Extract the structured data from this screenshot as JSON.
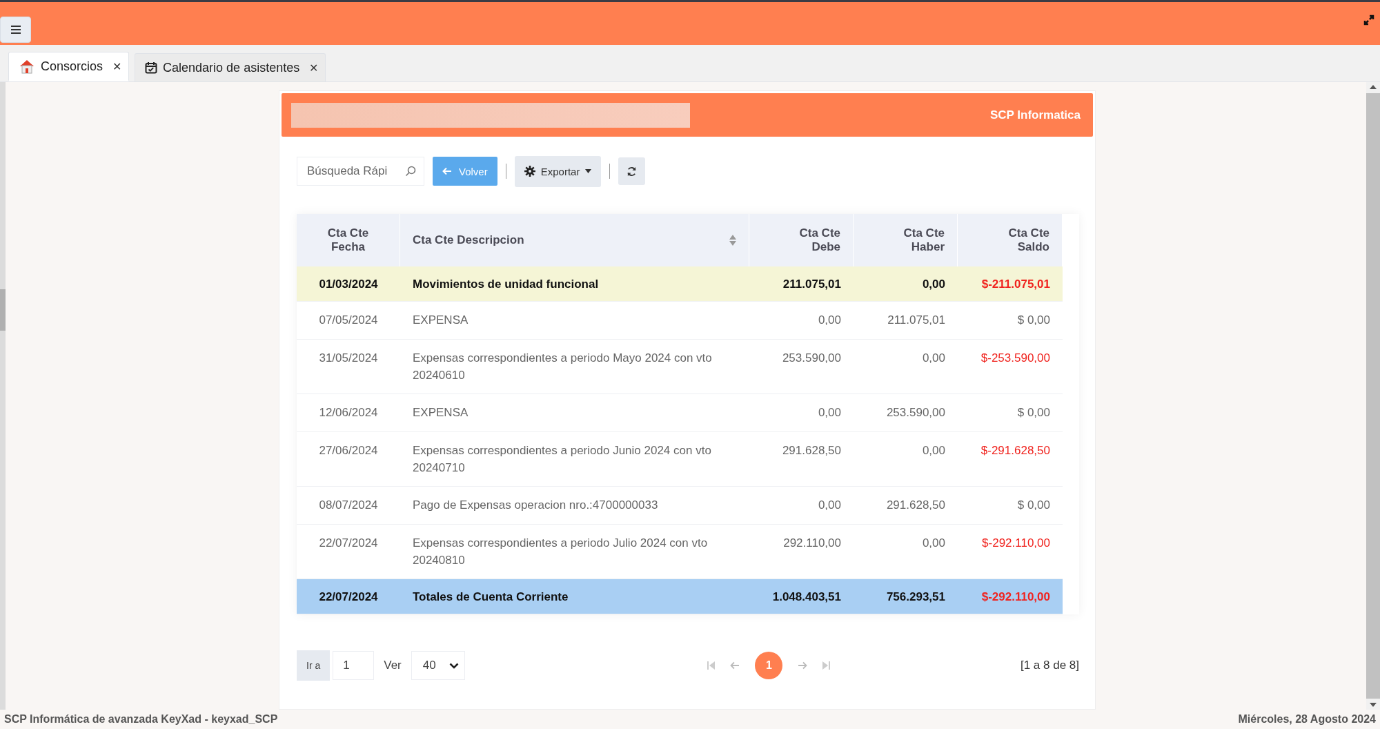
{
  "tabs": [
    {
      "label": "Consorcios",
      "close": "✕",
      "selected": true
    },
    {
      "label": "Calendario de asistentes",
      "close": "✕",
      "selected": false
    }
  ],
  "panel": {
    "brand": "SCP Informatica"
  },
  "toolbar": {
    "search": {
      "placeholder": "Búsqueda Rápi"
    },
    "back": "Volver",
    "export": "Exportar"
  },
  "table": {
    "columns": [
      {
        "label": "Cta Cte\nFecha"
      },
      {
        "label": "Cta Cte Descripcion"
      },
      {
        "label": "Cta Cte\nDebe"
      },
      {
        "label": "Cta Cte\nHaber"
      },
      {
        "label": "Cta Cte\nSaldo"
      }
    ],
    "rows": [
      {
        "kind": "group",
        "cells": [
          "01/03/2024",
          "Movimientos de unidad funcional",
          "211.075,01",
          "0,00",
          "$-211.075,01"
        ],
        "negative": true
      },
      {
        "kind": "entry",
        "cells": [
          "07/05/2024",
          "EXPENSA",
          "0,00",
          "211.075,01",
          "$ 0,00"
        ],
        "negative": false
      },
      {
        "kind": "entry",
        "cells": [
          "31/05/2024",
          "Expensas correspondientes a periodo Mayo 2024 con vto 20240610",
          "253.590,00",
          "0,00",
          "$-253.590,00"
        ],
        "negative": true
      },
      {
        "kind": "entry",
        "cells": [
          "12/06/2024",
          "EXPENSA",
          "0,00",
          "253.590,00",
          "$ 0,00"
        ],
        "negative": false
      },
      {
        "kind": "entry",
        "cells": [
          "27/06/2024",
          "Expensas correspondientes a periodo Junio 2024 con vto 20240710",
          "291.628,50",
          "0,00",
          "$-291.628,50"
        ],
        "negative": true
      },
      {
        "kind": "entry",
        "cells": [
          "08/07/2024",
          "Pago de Expensas operacion nro.:4700000033",
          "0,00",
          "291.628,50",
          "$ 0,00"
        ],
        "negative": false
      },
      {
        "kind": "entry",
        "cells": [
          "22/07/2024",
          "Expensas correspondientes a periodo Julio 2024 con vto 20240810",
          "292.110,00",
          "0,00",
          "$-292.110,00"
        ],
        "negative": true
      },
      {
        "kind": "total",
        "cells": [
          "22/07/2024",
          "Totales de Cuenta Corriente",
          "1.048.403,51",
          "756.293,51",
          "$-292.110,00"
        ],
        "negative": true
      }
    ]
  },
  "pager": {
    "goto_label": "Ir a",
    "goto_value": "1",
    "view_label": "Ver",
    "page_size": "40",
    "pages": [
      {
        "label": "1",
        "selected": true
      }
    ],
    "summary": "[1 a 8 de 8]"
  },
  "status_bar": {
    "left": "SCP Informática de avanzada KeyXad - keyxad_SCP",
    "right": "Miércoles, 28 Agosto 2024"
  }
}
